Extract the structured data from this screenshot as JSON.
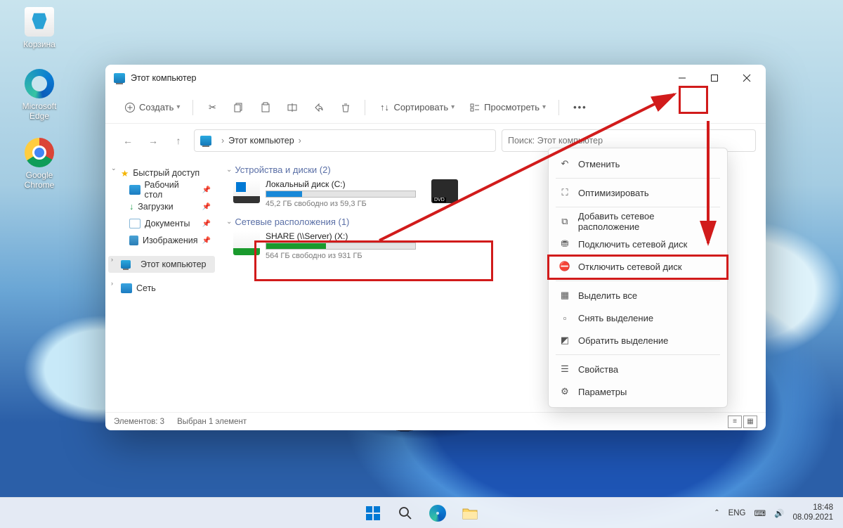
{
  "desktop": {
    "recycle": "Корзина",
    "edge": "Microsoft Edge",
    "chrome": "Google Chrome"
  },
  "window": {
    "title": "Этот компьютер",
    "toolbar": {
      "new": "Создать",
      "sort": "Сортировать",
      "view": "Просмотреть"
    },
    "breadcrumb": "Этот компьютер",
    "search_placeholder": "Поиск: Этот компьютер",
    "sidebar": {
      "quick": "Быстрый доступ",
      "desktop": "Рабочий стол",
      "downloads": "Загрузки",
      "documents": "Документы",
      "pictures": "Изображения",
      "thispc": "Этот компьютер",
      "network": "Сеть"
    },
    "groups": {
      "devices_label": "Устройства и диски (2)",
      "network_label": "Сетевые расположения (1)"
    },
    "drives": {
      "c_name": "Локальный диск (C:)",
      "c_free": "45,2 ГБ свободно из 59,3 ГБ",
      "c_fill_pct": 24,
      "share_name": "SHARE (\\\\Server) (X:)",
      "share_free": "564 ГБ свободно из 931 ГБ",
      "share_fill_pct": 40
    },
    "menu": {
      "undo": "Отменить",
      "optimize": "Оптимизировать",
      "add_net": "Добавить сетевое расположение",
      "map_drive": "Подключить сетевой диск",
      "disconnect": "Отключить сетевой диск",
      "select_all": "Выделить все",
      "select_none": "Снять выделение",
      "invert": "Обратить выделение",
      "properties": "Свойства",
      "options": "Параметры"
    },
    "status": {
      "count": "Элементов: 3",
      "selected": "Выбран 1 элемент"
    }
  },
  "taskbar": {
    "lang": "ENG",
    "time": "18:48",
    "date": "08.09.2021"
  }
}
